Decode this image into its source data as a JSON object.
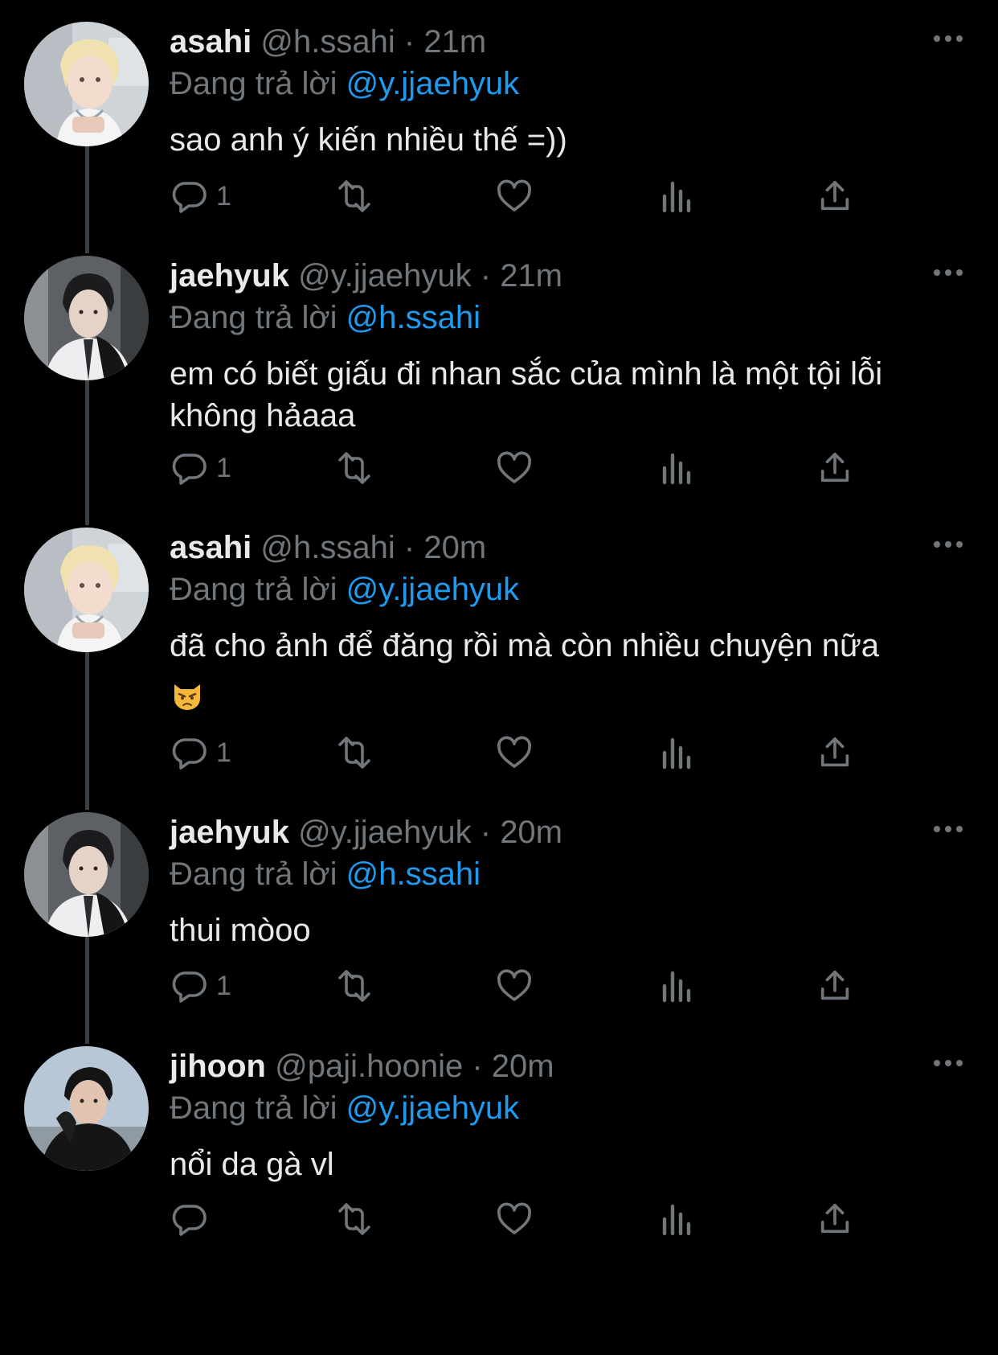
{
  "reply_prefix": "Đang trả lời",
  "colors": {
    "background": "#000000",
    "text": "#e7e9ea",
    "muted": "#71767b",
    "mention": "#1d9bf0",
    "thread_line": "#3a3f44"
  },
  "tweets": [
    {
      "name": "asahi",
      "handle": "@h.ssahi",
      "separator": "·",
      "time": "21m",
      "reply_to": "@y.jjaehyuk",
      "text": "sao anh ý kiến nhiều thế =))",
      "emoji": "",
      "reply_count": "1",
      "avatar": "avatar-asahi"
    },
    {
      "name": "jaehyuk",
      "handle": "@y.jjaehyuk",
      "separator": "·",
      "time": "21m",
      "reply_to": "@h.ssahi",
      "text": "em có biết giấu đi nhan sắc của mình là một tội lỗi không hảaaa",
      "emoji": "",
      "reply_count": "1",
      "avatar": "avatar-jaehyuk"
    },
    {
      "name": "asahi",
      "handle": "@h.ssahi",
      "separator": "·",
      "time": "20m",
      "reply_to": "@y.jjaehyuk",
      "text": "đã cho ảnh để đăng rồi mà còn nhiều chuyện nữa",
      "emoji": "pouting-cat-emoji",
      "reply_count": "1",
      "avatar": "avatar-asahi"
    },
    {
      "name": "jaehyuk",
      "handle": "@y.jjaehyuk",
      "separator": "·",
      "time": "20m",
      "reply_to": "@h.ssahi",
      "text": "thui mòoo",
      "emoji": "",
      "reply_count": "1",
      "avatar": "avatar-jaehyuk"
    },
    {
      "name": "jihoon",
      "handle": "@paji.hoonie",
      "separator": "·",
      "time": "20m",
      "reply_to": "@y.jjaehyuk",
      "text": "nổi da gà vl",
      "emoji": "",
      "reply_count": "",
      "avatar": "avatar-jihoon"
    }
  ],
  "icons": {
    "reply": "reply-bubble-icon",
    "retweet": "retweet-icon",
    "like": "heart-icon",
    "views": "analytics-icon",
    "share": "share-icon",
    "more": "more-dots-icon"
  }
}
